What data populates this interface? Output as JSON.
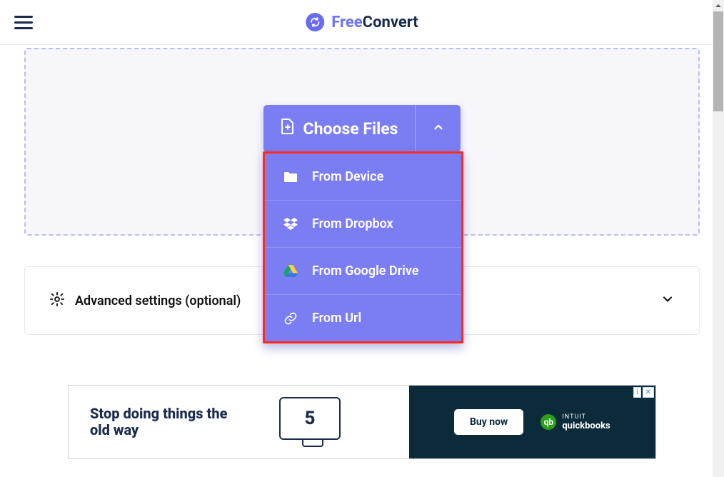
{
  "header": {
    "brand_free": "Free",
    "brand_convert": "Convert"
  },
  "upload": {
    "choose_label": "Choose Files",
    "menu": {
      "device": "From Device",
      "dropbox": "From Dropbox",
      "gdrive": "From Google Drive",
      "url": "From Url"
    }
  },
  "advanced": {
    "label": "Advanced settings (optional)"
  },
  "ad": {
    "headline": "Stop doing things the old way",
    "illus_number": "5",
    "cta": "Buy now",
    "sponsor_top": "INTUIT",
    "sponsor_bottom": "quickbooks",
    "badge_info": "i",
    "badge_close": "✕"
  }
}
